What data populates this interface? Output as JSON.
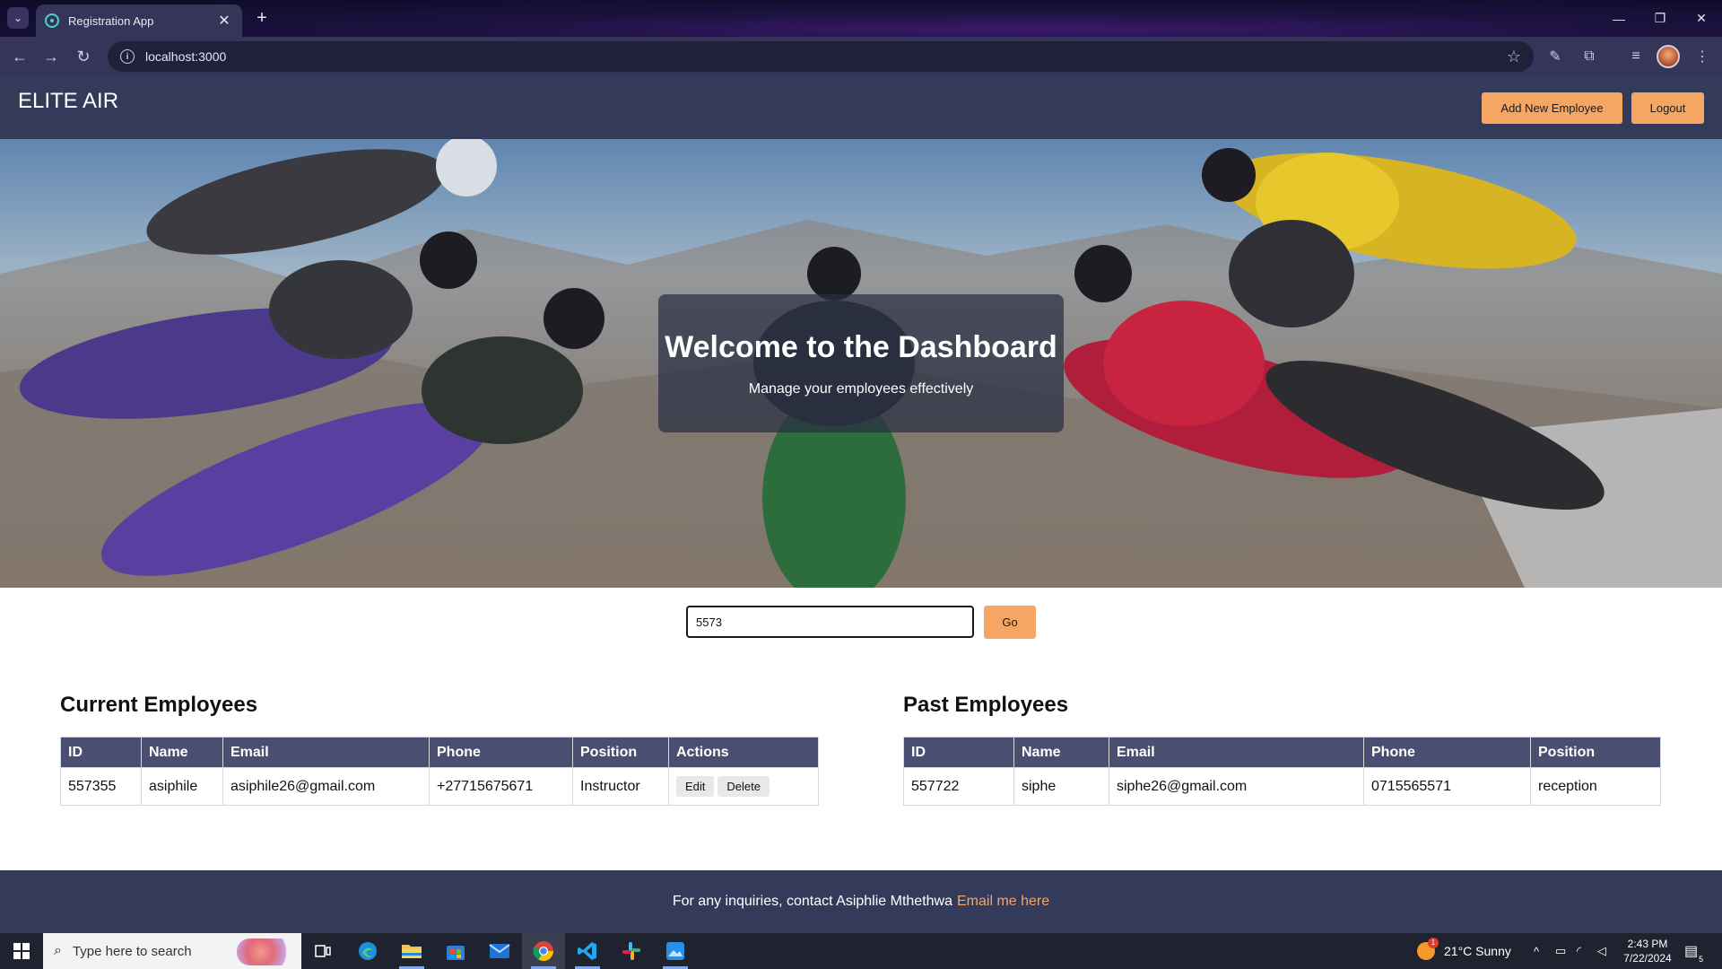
{
  "browser": {
    "tab_title": "Registration App",
    "tab_close": "✕",
    "new_tab": "+",
    "url": "localhost:3000",
    "window": {
      "minimize": "—",
      "restore": "❐",
      "close": "✕"
    }
  },
  "header": {
    "brand": "ELITE AIR",
    "add_employee_label": "Add New Employee",
    "logout_label": "Logout"
  },
  "hero": {
    "title": "Welcome to the Dashboard",
    "subtitle": "Manage your employees effectively"
  },
  "search": {
    "value": "5573",
    "go_label": "Go"
  },
  "current_employees": {
    "title": "Current Employees",
    "columns": [
      "ID",
      "Name",
      "Email",
      "Phone",
      "Position",
      "Actions"
    ],
    "rows": [
      {
        "id": "557355",
        "name": "asiphile",
        "email": "asiphile26@gmail.com",
        "phone": "+27715675671",
        "position": "Instructor",
        "edit_label": "Edit",
        "delete_label": "Delete"
      }
    ]
  },
  "past_employees": {
    "title": "Past Employees",
    "columns": [
      "ID",
      "Name",
      "Email",
      "Phone",
      "Position"
    ],
    "rows": [
      {
        "id": "557722",
        "name": "siphe",
        "email": "siphe26@gmail.com",
        "phone": "0715565571",
        "position": "reception"
      }
    ]
  },
  "footer": {
    "text": "For any inquiries, contact Asiphlie Mthethwa",
    "link_text": "Email me here"
  },
  "taskbar": {
    "search_placeholder": "Type here to search",
    "weather": "21°C  Sunny",
    "weather_badge": "1",
    "time": "2:43 PM",
    "date": "7/22/2024",
    "notification_count": "5"
  },
  "colors": {
    "header_bg": "#343a5a",
    "accent": "#f5a665",
    "table_header_bg": "#4a4f72"
  }
}
